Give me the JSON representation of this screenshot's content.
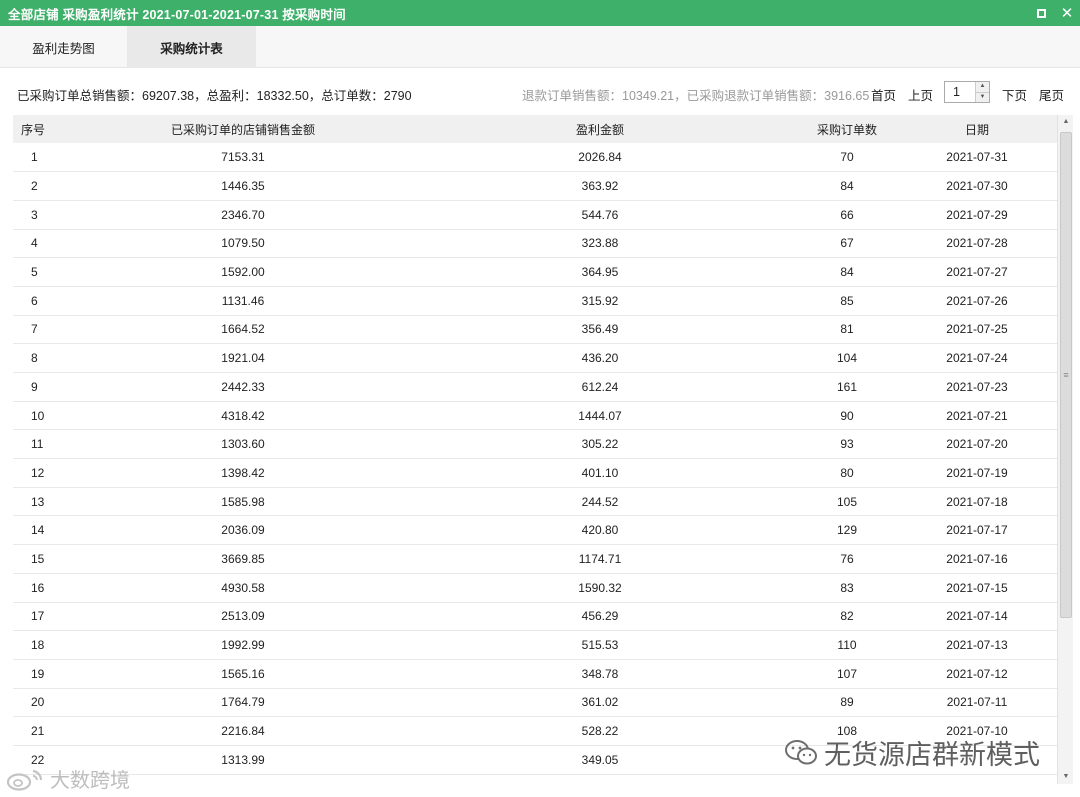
{
  "window": {
    "title": "全部店铺 采购盈利统计 2021-07-01-2021-07-31 按采购时间",
    "maximize_icon": "maximize-icon",
    "close_icon": "close-icon",
    "close_glyph": "✕"
  },
  "tabs": [
    {
      "label": "盈利走势图",
      "active": false
    },
    {
      "label": "采购统计表",
      "active": true
    }
  ],
  "summary": {
    "text": "已采购订单总销售额：69207.38，总盈利：18332.50，总订单数：2790",
    "refund_text": "退款订单销售额：10349.21，已采购退款订单销售额：3916.65"
  },
  "pager": {
    "first": "首页",
    "prev": "上页",
    "page": "1",
    "next": "下页",
    "last": "尾页"
  },
  "table": {
    "columns": [
      "序号",
      "已采购订单的店铺销售金额",
      "盈利金额",
      "采购订单数",
      "日期"
    ],
    "rows": [
      [
        "1",
        "7153.31",
        "2026.84",
        "70",
        "2021-07-31"
      ],
      [
        "2",
        "1446.35",
        "363.92",
        "84",
        "2021-07-30"
      ],
      [
        "3",
        "2346.70",
        "544.76",
        "66",
        "2021-07-29"
      ],
      [
        "4",
        "1079.50",
        "323.88",
        "67",
        "2021-07-28"
      ],
      [
        "5",
        "1592.00",
        "364.95",
        "84",
        "2021-07-27"
      ],
      [
        "6",
        "1131.46",
        "315.92",
        "85",
        "2021-07-26"
      ],
      [
        "7",
        "1664.52",
        "356.49",
        "81",
        "2021-07-25"
      ],
      [
        "8",
        "1921.04",
        "436.20",
        "104",
        "2021-07-24"
      ],
      [
        "9",
        "2442.33",
        "612.24",
        "161",
        "2021-07-23"
      ],
      [
        "10",
        "4318.42",
        "1444.07",
        "90",
        "2021-07-21"
      ],
      [
        "11",
        "1303.60",
        "305.22",
        "93",
        "2021-07-20"
      ],
      [
        "12",
        "1398.42",
        "401.10",
        "80",
        "2021-07-19"
      ],
      [
        "13",
        "1585.98",
        "244.52",
        "105",
        "2021-07-18"
      ],
      [
        "14",
        "2036.09",
        "420.80",
        "129",
        "2021-07-17"
      ],
      [
        "15",
        "3669.85",
        "1174.71",
        "76",
        "2021-07-16"
      ],
      [
        "16",
        "4930.58",
        "1590.32",
        "83",
        "2021-07-15"
      ],
      [
        "17",
        "2513.09",
        "456.29",
        "82",
        "2021-07-14"
      ],
      [
        "18",
        "1992.99",
        "515.53",
        "110",
        "2021-07-13"
      ],
      [
        "19",
        "1565.16",
        "348.78",
        "107",
        "2021-07-12"
      ],
      [
        "20",
        "1764.79",
        "361.02",
        "89",
        "2021-07-11"
      ],
      [
        "21",
        "2216.84",
        "528.22",
        "108",
        "2021-07-10"
      ],
      [
        "22",
        "1313.99",
        "349.05",
        "",
        ""
      ]
    ]
  },
  "watermarks": {
    "left": "大数跨境",
    "right": "无货源店群新模式"
  },
  "colors": {
    "titlebar": "#3eb06a",
    "refund_text": "#999999",
    "header_bg": "#f0f0f0"
  }
}
